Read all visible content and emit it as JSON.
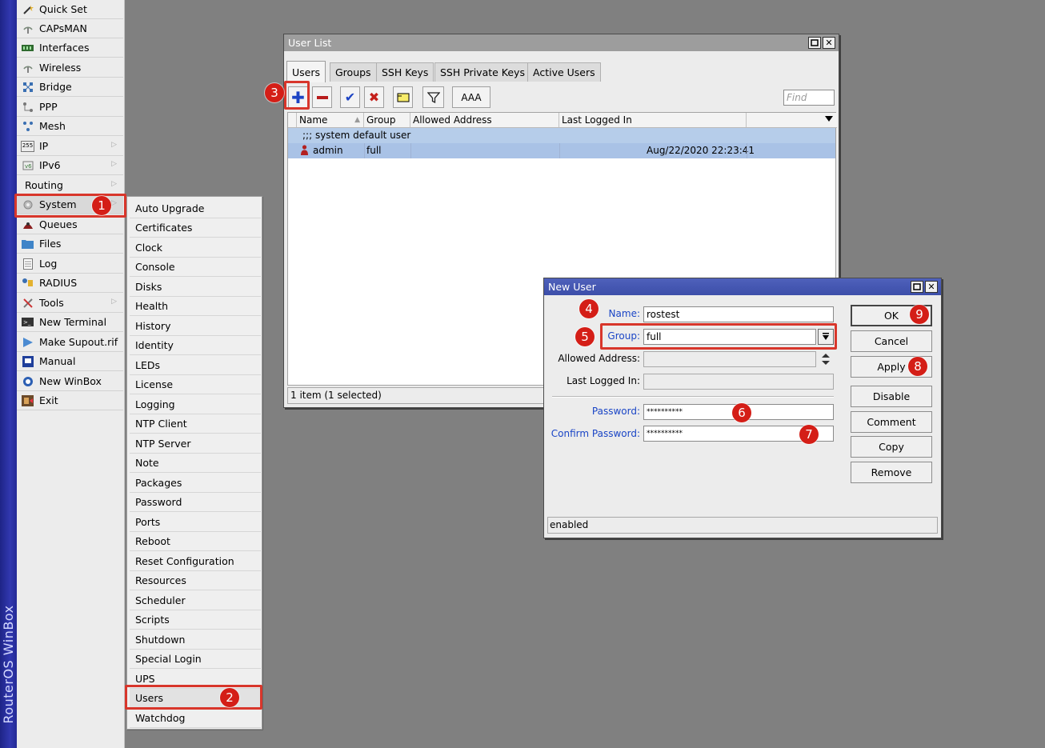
{
  "app_vertical_title": "RouterOS WinBox",
  "sidebar": {
    "items": [
      {
        "label": "Quick Set",
        "icon": "wand-icon"
      },
      {
        "label": "CAPsMAN",
        "icon": "wireless-icon"
      },
      {
        "label": "Interfaces",
        "icon": "interfaces-icon"
      },
      {
        "label": "Wireless",
        "icon": "wireless-icon"
      },
      {
        "label": "Bridge",
        "icon": "bridge-icon"
      },
      {
        "label": "PPP",
        "icon": "ppp-icon"
      },
      {
        "label": "Mesh",
        "icon": "mesh-icon"
      },
      {
        "label": "IP",
        "icon": "ip-icon"
      },
      {
        "label": "IPv6",
        "icon": "ipv6-icon"
      },
      {
        "label": "Routing",
        "icon": ""
      },
      {
        "label": "System",
        "icon": "system-icon"
      },
      {
        "label": "Queues",
        "icon": "queues-icon"
      },
      {
        "label": "Files",
        "icon": "files-icon"
      },
      {
        "label": "Log",
        "icon": "log-icon"
      },
      {
        "label": "RADIUS",
        "icon": "radius-icon"
      },
      {
        "label": "Tools",
        "icon": "tools-icon"
      },
      {
        "label": "New Terminal",
        "icon": "terminal-icon"
      },
      {
        "label": "Make Supout.rif",
        "icon": "supout-icon"
      },
      {
        "label": "Manual",
        "icon": "manual-icon"
      },
      {
        "label": "New WinBox",
        "icon": "winbox-icon"
      },
      {
        "label": "Exit",
        "icon": "exit-icon"
      }
    ]
  },
  "system_submenu": {
    "items": [
      "Auto Upgrade",
      "Certificates",
      "Clock",
      "Console",
      "Disks",
      "Health",
      "History",
      "Identity",
      "LEDs",
      "License",
      "Logging",
      "NTP Client",
      "NTP Server",
      "Note",
      "Packages",
      "Password",
      "Ports",
      "Reboot",
      "Reset Configuration",
      "Resources",
      "Scheduler",
      "Scripts",
      "Shutdown",
      "Special Login",
      "UPS",
      "Users",
      "Watchdog"
    ]
  },
  "user_list": {
    "title": "User List",
    "tabs": [
      "Users",
      "Groups",
      "SSH Keys",
      "SSH Private Keys",
      "Active Users"
    ],
    "toolbar": {
      "aaa_label": "AAA",
      "find_placeholder": "Find"
    },
    "columns": [
      "Name",
      "Group",
      "Allowed Address",
      "Last Logged In"
    ],
    "comment_row": ";;; system default user",
    "rows": [
      {
        "name": "admin",
        "group": "full",
        "allowed_address": "",
        "last_logged_in": "Aug/22/2020 22:23:41"
      }
    ],
    "status": "1 item (1 selected)"
  },
  "new_user": {
    "title": "New User",
    "fields": {
      "name": {
        "label": "Name:",
        "value": "rostest"
      },
      "group": {
        "label": "Group:",
        "value": "full"
      },
      "allowed_address": {
        "label": "Allowed Address:",
        "value": ""
      },
      "last_logged_in": {
        "label": "Last Logged In:",
        "value": ""
      },
      "password": {
        "label": "Password:",
        "value": "**********"
      },
      "confirm_password": {
        "label": "Confirm Password:",
        "value": "**********"
      }
    },
    "buttons": [
      "OK",
      "Cancel",
      "Apply",
      "Disable",
      "Comment",
      "Copy",
      "Remove"
    ],
    "status": "enabled"
  },
  "annotations": [
    "1",
    "2",
    "3",
    "4",
    "5",
    "6",
    "7",
    "8",
    "9"
  ],
  "colors": {
    "highlight": "#d8362b",
    "badge": "#d41e17",
    "title_active": "#3c4ea9",
    "selection": "#b6cdea",
    "blue_label": "#1a45c6"
  }
}
